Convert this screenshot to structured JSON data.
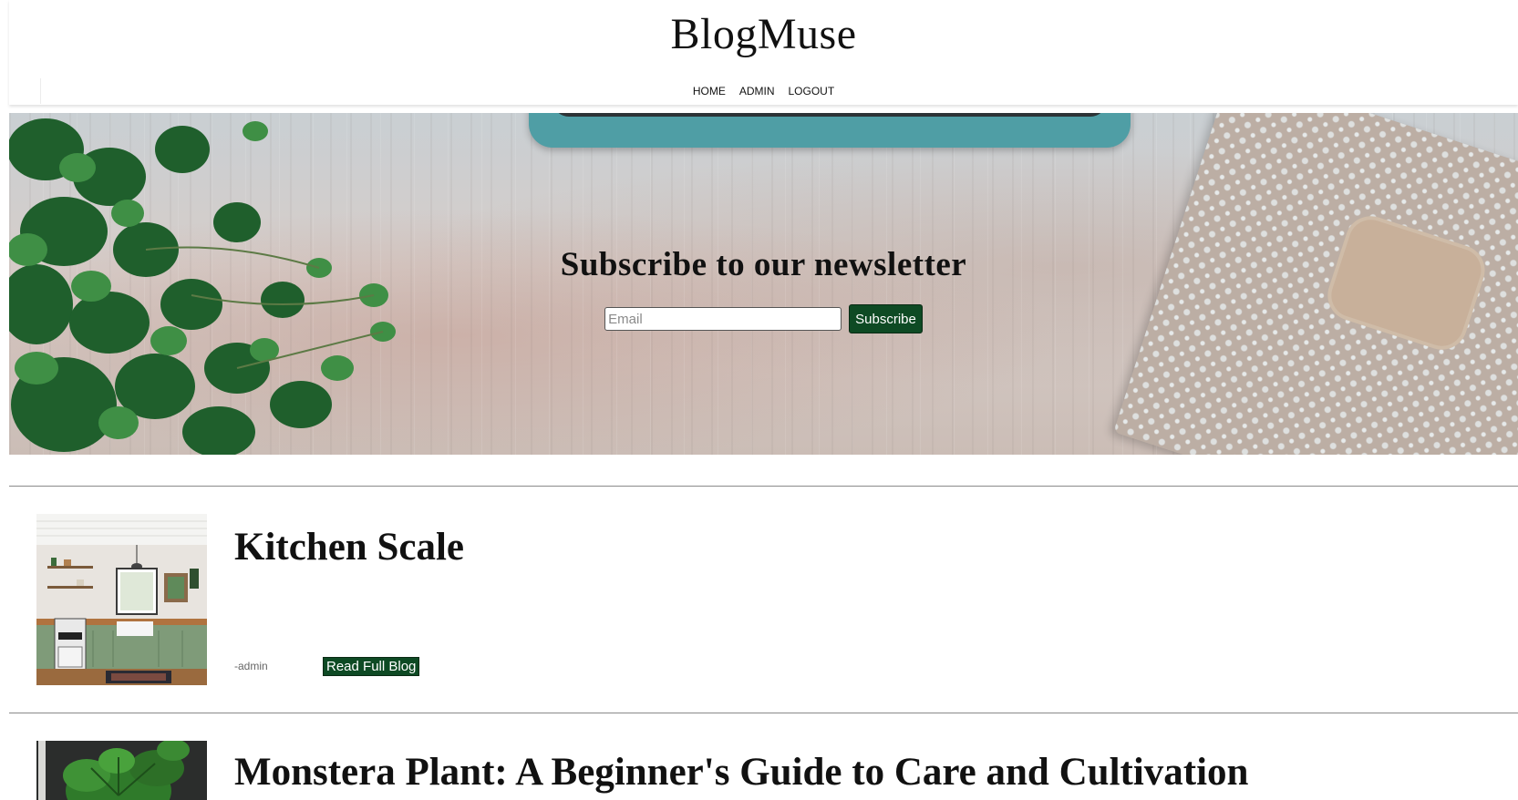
{
  "header": {
    "brand": "BlogMuse",
    "nav": [
      {
        "label": "HOME"
      },
      {
        "label": "ADMIN"
      },
      {
        "label": "LOGOUT"
      }
    ]
  },
  "hero": {
    "title": "Subscribe to our newsletter",
    "email_placeholder": "Email",
    "subscribe_label": "Subscribe"
  },
  "posts": [
    {
      "title": "Kitchen Scale",
      "author": "-admin",
      "button_label": "Read Full Blog"
    },
    {
      "title": "Monstera Plant: A Beginner's Guide to Care and Cultivation"
    }
  ],
  "colors": {
    "button_green": "#0e4a24",
    "divider": "#8a8a8a"
  }
}
